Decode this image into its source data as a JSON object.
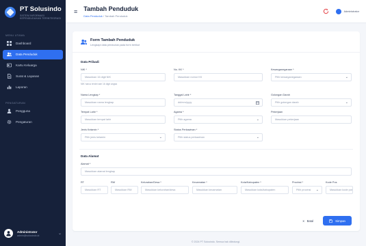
{
  "brand": {
    "name": "PT Solusindo",
    "subtitle": "SISTEM INFORMASI KEPENDUDUKAN TERINTEGRASI"
  },
  "sidebar": {
    "section_main": "MENU UTAMA",
    "section_other": "PENGATURAN",
    "items": [
      {
        "label": "Dashboard",
        "icon": "grid-icon"
      },
      {
        "label": "Data Penduduk",
        "icon": "users-icon",
        "active": true
      },
      {
        "label": "Kartu Keluarga",
        "icon": "card-icon"
      },
      {
        "label": "Surat & Layanan",
        "icon": "file-icon"
      },
      {
        "label": "Laporan",
        "icon": "chart-icon"
      }
    ],
    "items_other": [
      {
        "label": "Pengguna",
        "icon": "user-icon"
      },
      {
        "label": "Pengaturan",
        "icon": "gear-icon"
      }
    ],
    "user": {
      "name": "Administrator",
      "email": "admin@solusindo.id"
    }
  },
  "topbar": {
    "title": "Tambah Penduduk",
    "breadcrumb_link": "Data Penduduk",
    "breadcrumb_sep": "/",
    "breadcrumb_current": "Tambah Penduduk",
    "user_label": "Administrator"
  },
  "form": {
    "title": "Form Tambah Penduduk",
    "subtitle": "Lengkapi data penduduk pada form berikut",
    "section_personal": "Data Pribadi",
    "section_address": "Data Alamat",
    "nik": {
      "label": "NIK *",
      "placeholder": "Masukkan 16 digit NIK",
      "hint": "NIK harus terdiri dari 16 digit angka"
    },
    "no_kk": {
      "label": "No. KK *",
      "placeholder": "Masukkan nomor KK"
    },
    "kewarganegaraan": {
      "label": "Kewarganegaraan *",
      "placeholder": "Pilih kewarganegaraan"
    },
    "nama": {
      "label": "Nama Lengkap *",
      "placeholder": "Masukkan nama lengkap"
    },
    "tanggal_lahir": {
      "label": "Tanggal Lahir *",
      "placeholder": "dd/mm/yyyy"
    },
    "golongan_darah": {
      "label": "Golongan Darah",
      "placeholder": "Pilih golongan darah"
    },
    "tempat_lahir": {
      "label": "Tempat Lahir *",
      "placeholder": "Masukkan tempat lahir"
    },
    "agama": {
      "label": "Agama *",
      "placeholder": "Pilih agama"
    },
    "pekerjaan": {
      "label": "Pekerjaan",
      "placeholder": "Masukkan pekerjaan"
    },
    "jenis_kelamin": {
      "label": "Jenis Kelamin *",
      "placeholder": "Pilih jenis kelamin"
    },
    "status_perkawinan": {
      "label": "Status Perkawinan *",
      "placeholder": "Pilih status perkawinan"
    },
    "alamat": {
      "label": "Alamat *",
      "placeholder": "Masukkan alamat lengkap"
    },
    "rt": {
      "label": "RT",
      "placeholder": "Masukkan RT"
    },
    "rw": {
      "label": "RW",
      "placeholder": "Masukkan RW"
    },
    "kelurahan": {
      "label": "Kelurahan/Desa *",
      "placeholder": "Masukkan kelurahan/desa"
    },
    "kecamatan": {
      "label": "Kecamatan *",
      "placeholder": "Masukkan kecamatan"
    },
    "kota": {
      "label": "Kota/Kabupaten *",
      "placeholder": "Masukkan kota/kabupaten"
    },
    "provinsi": {
      "label": "Provinsi *",
      "placeholder": "Pilih provinsi"
    },
    "kode_pos": {
      "label": "Kode Pos",
      "placeholder": "Masukkan kode pos"
    },
    "cancel_label": "Batal",
    "save_label": "Simpan"
  },
  "footer": "© 2024 PT Solusindo. Semua hak dilindungi."
}
